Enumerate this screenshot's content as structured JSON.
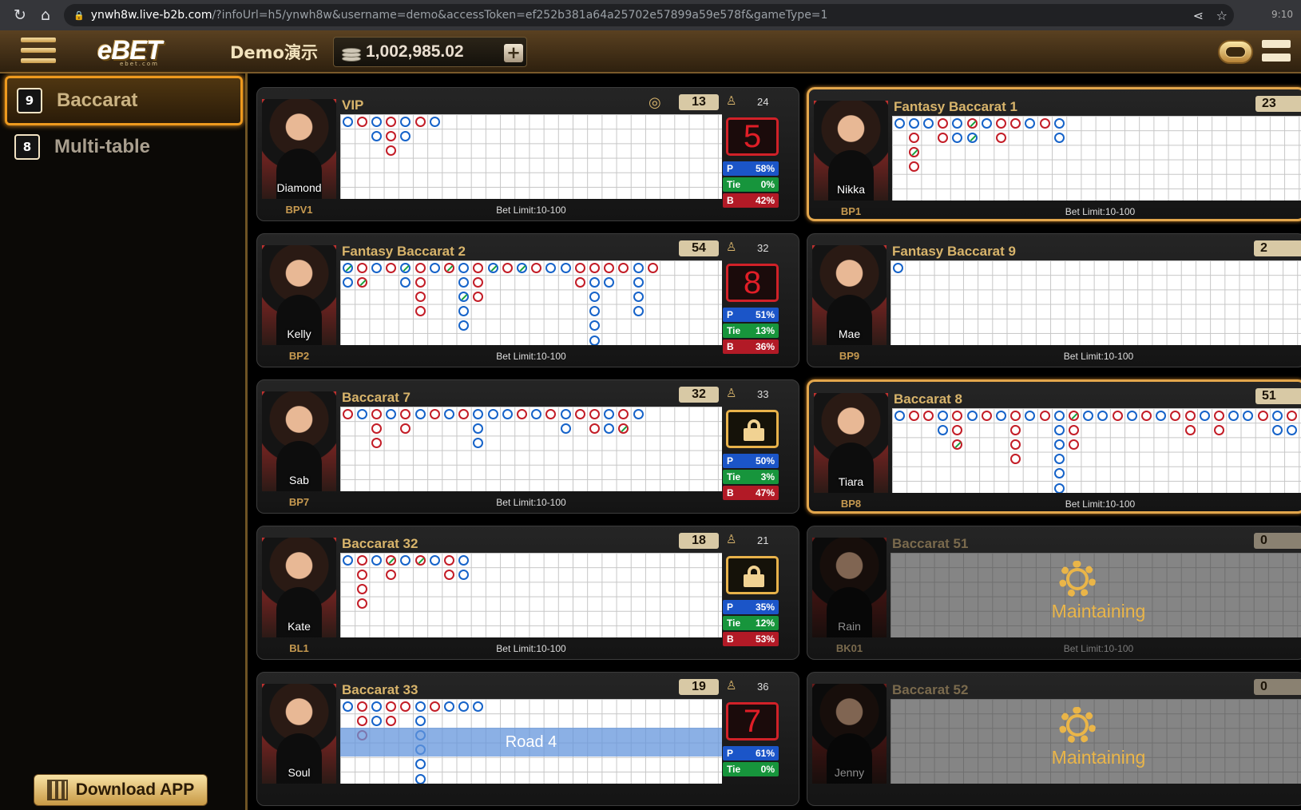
{
  "browser": {
    "url_host": "ynwh8w.live-b2b.com",
    "url_path": "/?infoUrl=h5/ynwh8w&username=demo&accessToken=ef252b381a64a25702e57899a59e578f&gameType=1",
    "clock": "9:10"
  },
  "header": {
    "logo_text": "eBET",
    "logo_sub": "ebet.com",
    "demo_label": "Demo演示",
    "balance": "1,002,985.02",
    "add_label": "+"
  },
  "sidebar": {
    "items": [
      {
        "label": "Baccarat",
        "icon_text": "9"
      },
      {
        "label": "Multi-table",
        "icon_text": "8"
      }
    ],
    "download_label": "Download APP"
  },
  "tables": [
    {
      "name": "VIP",
      "code": "BPV1",
      "dealer": "Diamond",
      "round": "13",
      "players": "24",
      "bet_limit": "Bet Limit:10-100",
      "status": "result",
      "result": "5",
      "p": "58%",
      "tie": "0%",
      "b": "42%",
      "vip": true,
      "road": [
        [
          "p"
        ],
        [
          "b"
        ],
        [
          "p",
          "p"
        ],
        [
          "b",
          "b",
          "b"
        ],
        [
          "p",
          "p"
        ],
        [
          "b"
        ],
        [
          "p"
        ]
      ]
    },
    {
      "name": "Fantasy Baccarat 1",
      "code": "BP1",
      "dealer": "Nikka",
      "round": "23",
      "players": "",
      "bet_limit": "Bet Limit:10-100",
      "status": "open",
      "highlight": true,
      "road": [
        [
          "p"
        ],
        [
          "p",
          "b",
          "bt",
          "b"
        ],
        [
          "p"
        ],
        [
          "b",
          "b"
        ],
        [
          "p",
          "p"
        ],
        [
          "bt",
          "pt"
        ],
        [
          "p"
        ],
        [
          "b",
          "b"
        ],
        [
          "b"
        ],
        [
          "p"
        ],
        [
          "b"
        ],
        [
          "p",
          "p"
        ]
      ]
    },
    {
      "name": "Fantasy Baccarat 2",
      "code": "BP2",
      "dealer": "Kelly",
      "round": "54",
      "players": "32",
      "bet_limit": "Bet Limit:10-100",
      "status": "result",
      "result": "8",
      "p": "51%",
      "tie": "13%",
      "b": "36%",
      "road": [
        [
          "pt",
          "p"
        ],
        [
          "b",
          "bt"
        ],
        [
          "p"
        ],
        [
          "b"
        ],
        [
          "pt",
          "p"
        ],
        [
          "b",
          "b",
          "b",
          "b"
        ],
        [
          "p"
        ],
        [
          "bt"
        ],
        [
          "p",
          "p",
          "pt",
          "p",
          "p"
        ],
        [
          "b",
          "b",
          "b"
        ],
        [
          "pt"
        ],
        [
          "b"
        ],
        [
          "pt"
        ],
        [
          "b"
        ],
        [
          "p"
        ],
        [
          "p"
        ],
        [
          "b",
          "b"
        ],
        [
          "b",
          "p",
          "p",
          "p",
          "p",
          "p"
        ],
        [
          "b",
          "p"
        ],
        [
          "b"
        ],
        [
          "p",
          "p",
          "p",
          "p"
        ],
        [
          "b"
        ]
      ]
    },
    {
      "name": "Fantasy Baccarat 9",
      "code": "BP9",
      "dealer": "Mae",
      "round": "2",
      "players": "",
      "bet_limit": "Bet Limit:10-100",
      "status": "open",
      "road": [
        [
          "p"
        ]
      ]
    },
    {
      "name": "Baccarat 7",
      "code": "BP7",
      "dealer": "Sab",
      "round": "32",
      "players": "33",
      "bet_limit": "Bet Limit:10-100",
      "status": "locked",
      "p": "50%",
      "tie": "3%",
      "b": "47%",
      "road": [
        [
          "b"
        ],
        [
          "p"
        ],
        [
          "b",
          "b",
          "b"
        ],
        [
          "p"
        ],
        [
          "b",
          "b"
        ],
        [
          "p"
        ],
        [
          "b"
        ],
        [
          "p"
        ],
        [
          "b"
        ],
        [
          "p",
          "p",
          "p"
        ],
        [
          "p"
        ],
        [
          "p"
        ],
        [
          "b"
        ],
        [
          "p"
        ],
        [
          "b"
        ],
        [
          "p",
          "p"
        ],
        [
          "b"
        ],
        [
          "b",
          "b"
        ],
        [
          "p",
          "p"
        ],
        [
          "b",
          "bt"
        ],
        [
          "p"
        ]
      ]
    },
    {
      "name": "Baccarat 8",
      "code": "BP8",
      "dealer": "Tiara",
      "round": "51",
      "players": "",
      "bet_limit": "Bet Limit:10-100",
      "status": "open",
      "highlight": true,
      "road": [
        [
          "p"
        ],
        [
          "b"
        ],
        [
          "b"
        ],
        [
          "p",
          "p"
        ],
        [
          "b",
          "b",
          "bt"
        ],
        [
          "p"
        ],
        [
          "b"
        ],
        [
          "p"
        ],
        [
          "b",
          "b",
          "b",
          "b"
        ],
        [
          "p"
        ],
        [
          "b"
        ],
        [
          "p",
          "p",
          "p",
          "p",
          "p",
          "p"
        ],
        [
          "bt",
          "b",
          "b"
        ],
        [
          "p"
        ],
        [
          "p"
        ],
        [
          "b"
        ],
        [
          "p"
        ],
        [
          "b"
        ],
        [
          "p"
        ],
        [
          "b"
        ],
        [
          "b",
          "b"
        ],
        [
          "p"
        ],
        [
          "b",
          "b"
        ],
        [
          "p"
        ],
        [
          "p"
        ],
        [
          "b"
        ],
        [
          "p",
          "p"
        ],
        [
          "b",
          "p"
        ]
      ]
    },
    {
      "name": "Baccarat 32",
      "code": "BL1",
      "dealer": "Kate",
      "round": "18",
      "players": "21",
      "bet_limit": "Bet Limit:10-100",
      "status": "locked",
      "p": "35%",
      "tie": "12%",
      "b": "53%",
      "road": [
        [
          "p"
        ],
        [
          "b",
          "b",
          "b",
          "b"
        ],
        [
          "p"
        ],
        [
          "bt",
          "b"
        ],
        [
          "p"
        ],
        [
          "bt"
        ],
        [
          "p"
        ],
        [
          "b",
          "b"
        ],
        [
          "p",
          "p"
        ]
      ]
    },
    {
      "name": "Baccarat 51",
      "code": "BK01",
      "dealer": "Rain",
      "round": "0",
      "players": "",
      "bet_limit": "Bet Limit:10-100",
      "status": "maintaining",
      "maint_label": "Maintaining",
      "road": []
    },
    {
      "name": "Baccarat 33",
      "code": "",
      "dealer": "Soul",
      "round": "19",
      "players": "36",
      "bet_limit": "",
      "status": "result",
      "result": "7",
      "p": "61%",
      "tie": "0%",
      "b": "",
      "overlay": "Road 4",
      "road": [
        [
          "p"
        ],
        [
          "b",
          "b",
          "b"
        ],
        [
          "p",
          "p"
        ],
        [
          "b",
          "b"
        ],
        [
          "b"
        ],
        [
          "p",
          "p",
          "p",
          "p",
          "p",
          "p"
        ],
        [
          "b"
        ],
        [
          "p"
        ],
        [
          "p"
        ],
        [
          "p"
        ]
      ]
    },
    {
      "name": "Baccarat 52",
      "code": "",
      "dealer": "Jenny",
      "round": "0",
      "players": "",
      "bet_limit": "",
      "status": "maintaining",
      "maint_label": "Maintaining",
      "road": []
    }
  ]
}
